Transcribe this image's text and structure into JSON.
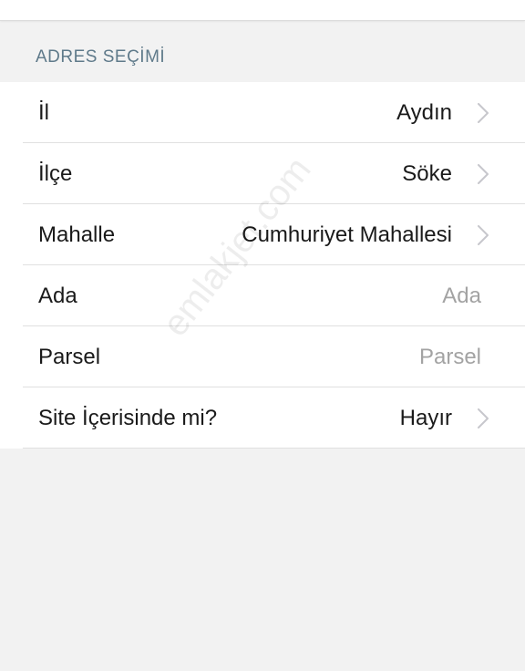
{
  "section": {
    "title": "ADRES SEÇİMİ"
  },
  "rows": [
    {
      "label": "İl",
      "value": "Aydın"
    },
    {
      "label": "İlçe",
      "value": "Söke"
    },
    {
      "label": "Mahalle",
      "value": "Cumhuriyet Mahallesi"
    },
    {
      "label": "Ada",
      "placeholder": "Ada"
    },
    {
      "label": "Parsel",
      "placeholder": "Parsel"
    },
    {
      "label": "Site İçerisinde mi?",
      "value": "Hayır"
    }
  ],
  "watermark": "emlakjet.com",
  "colors": {
    "background": "#f2f2f2",
    "section_header": "#5f7a8a",
    "placeholder": "#a3a3a3",
    "chevron": "#c7c7cc"
  },
  "icons": {
    "disclosure": "chevron-right-icon"
  }
}
